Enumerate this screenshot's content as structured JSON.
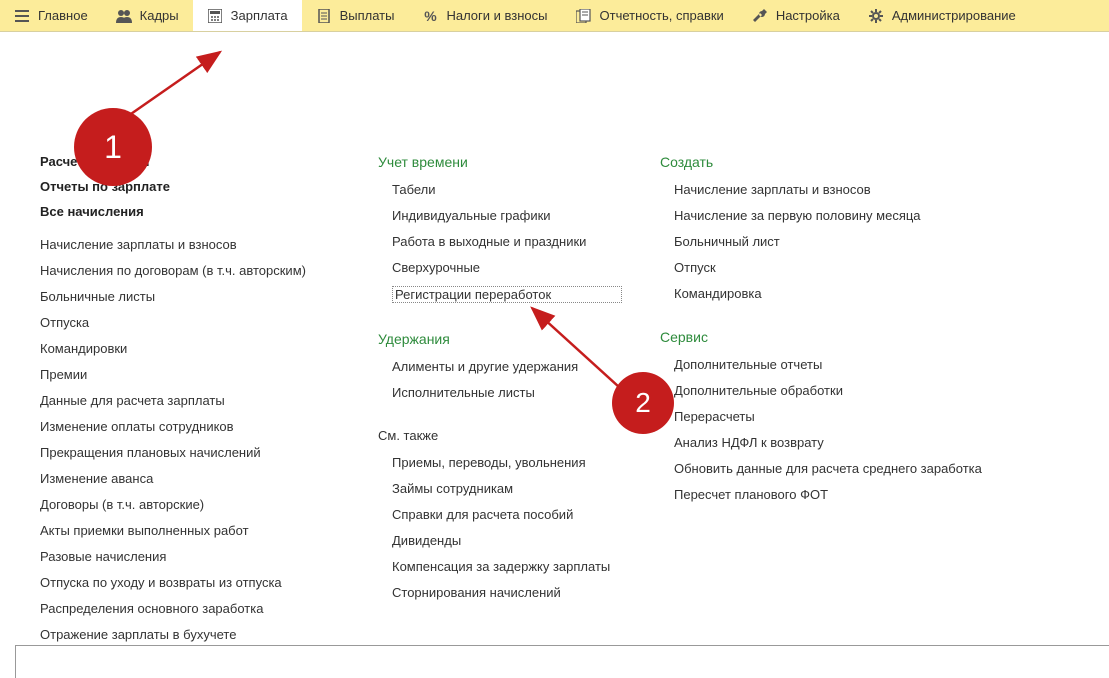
{
  "toolbar": {
    "items": [
      {
        "label": "Главное",
        "icon": "menu"
      },
      {
        "label": "Кадры",
        "icon": "people"
      },
      {
        "label": "Зарплата",
        "icon": "calc",
        "active": true
      },
      {
        "label": "Выплаты",
        "icon": "doc"
      },
      {
        "label": "Налоги и взносы",
        "icon": "percent"
      },
      {
        "label": "Отчетность, справки",
        "icon": "report"
      },
      {
        "label": "Настройка",
        "icon": "wrench"
      },
      {
        "label": "Администрирование",
        "icon": "gear"
      }
    ]
  },
  "badges": {
    "b1": "1",
    "b2": "2"
  },
  "col1": {
    "bold": [
      "Расчет зарплаты",
      "Отчеты по зарплате",
      "Все начисления"
    ],
    "items": [
      "Начисление зарплаты и взносов",
      "Начисления по договорам (в т.ч. авторским)",
      "Больничные листы",
      "Отпуска",
      "Командировки",
      "Премии",
      "Данные для расчета зарплаты",
      "Изменение оплаты сотрудников",
      "Прекращения плановых начислений",
      "Изменение аванса",
      "Договоры (в т.ч. авторские)",
      "Акты приемки выполненных работ",
      "Разовые начисления",
      "Отпуска по уходу и возвраты из отпуска",
      "Распределения основного заработка",
      "Отражение зарплаты в бухучете"
    ]
  },
  "col2": {
    "h1": "Учет времени",
    "items1": [
      "Табели",
      "Индивидуальные графики",
      "Работа в выходные и праздники",
      "Сверхурочные",
      "Регистрации переработок"
    ],
    "h2": "Удержания",
    "items2": [
      "Алименты и другие удержания",
      "Исполнительные листы"
    ],
    "h3": "См. также",
    "items3": [
      "Приемы, переводы, увольнения",
      "Займы сотрудникам",
      "Справки для расчета пособий",
      "Дивиденды",
      "Компенсация за задержку зарплаты",
      "Сторнирования начислений"
    ]
  },
  "col3": {
    "h1": "Создать",
    "items1": [
      "Начисление зарплаты и взносов",
      "Начисление за первую половину месяца",
      "Больничный лист",
      "Отпуск",
      "Командировка"
    ],
    "h2": "Сервис",
    "items2": [
      "Дополнительные отчеты",
      "Дополнительные обработки",
      "Перерасчеты",
      "Анализ НДФЛ к возврату",
      "Обновить данные для расчета среднего заработка",
      "Пересчет планового ФОТ"
    ]
  }
}
